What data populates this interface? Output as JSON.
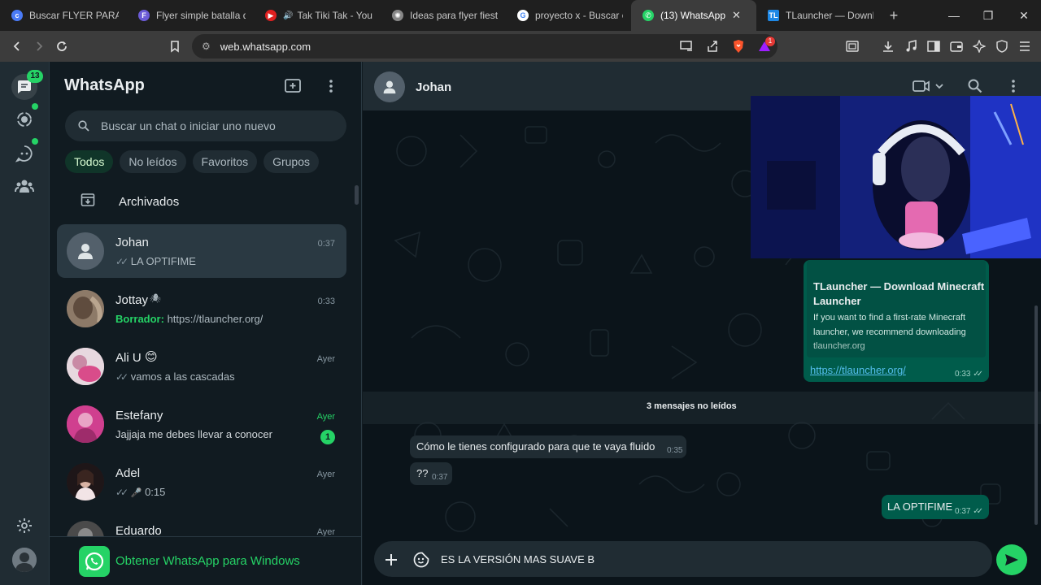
{
  "browser": {
    "tabs": [
      {
        "label": "Buscar FLYER PARA FI",
        "active": false
      },
      {
        "label": "Flyer simple batalla de",
        "active": false
      },
      {
        "label": "Tak Tiki Tak - YouT",
        "active": false
      },
      {
        "label": "Ideas para flyer fiesta",
        "active": false
      },
      {
        "label": "proyecto x - Buscar co",
        "active": false
      },
      {
        "label": "(13) WhatsApp",
        "active": true
      },
      {
        "label": "TLauncher — Downlo",
        "active": false
      }
    ],
    "url": "web.whatsapp.com",
    "notification_count": "1"
  },
  "rail": {
    "chats_badge": "13"
  },
  "sidebar": {
    "title": "WhatsApp",
    "search_placeholder": "Buscar un chat o iniciar uno nuevo",
    "filters": [
      "Todos",
      "No leídos",
      "Favoritos",
      "Grupos"
    ],
    "active_filter": "Todos",
    "archived_label": "Archivados",
    "get_app_label": "Obtener WhatsApp para Windows"
  },
  "chats": [
    {
      "name": "Johan",
      "time": "0:37",
      "preview": "LA OPTIFIME",
      "ticks": true,
      "selected": true
    },
    {
      "name": "Jottay",
      "time": "0:33",
      "draft_label": "Borrador:",
      "preview": "https://tlauncher.org/"
    },
    {
      "name": "Ali U",
      "emoji": "😊",
      "time": "Ayer",
      "preview": "vamos a las cascadas",
      "ticks": true
    },
    {
      "name": "Estefany",
      "time": "Ayer",
      "preview": "Jajjaja me debes llevar a conocer",
      "unread": "1",
      "time_green": true
    },
    {
      "name": "Adel",
      "time": "Ayer",
      "preview": "0:15",
      "ticks": true,
      "voice": true
    },
    {
      "name": "Eduardo",
      "time": "Ayer",
      "preview": ""
    }
  ],
  "conversation": {
    "contact_name": "Johan",
    "link_card": {
      "title": "TLauncher — Download Minecraft Launcher",
      "description": "If you want to find a first-rate Minecraft launcher, we recommend downloading",
      "domain": "tlauncher.org",
      "url": "https://tlauncher.org/",
      "time": "0:33"
    },
    "unread_separator": "3 mensajes no leídos",
    "messages": [
      {
        "text": "Cómo le tienes configurado para que te vaya fluido",
        "time": "0:35",
        "direction": "in"
      },
      {
        "text": "??",
        "time": "0:37",
        "direction": "in"
      },
      {
        "text": "LA OPTIFIME",
        "time": "0:37",
        "direction": "out"
      }
    ],
    "compose_value": "ES LA VERSIÓN MAS SUAVE B"
  },
  "colors": {
    "accent": "#25d366",
    "panel_bg": "#111b21",
    "header_bg": "#202c33",
    "outgoing_bubble": "#005c4b",
    "incoming_bubble": "#202c33"
  }
}
